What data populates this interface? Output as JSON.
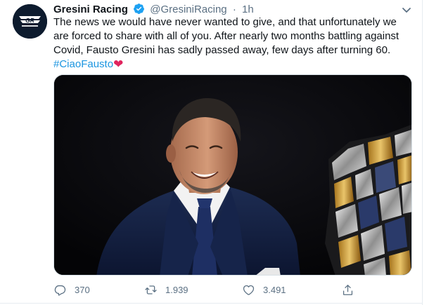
{
  "tweet": {
    "author": {
      "name": "Gresini Racing",
      "handle": "@GresiniRacing",
      "verified": true,
      "avatar_icon": "gresini-racing-logo",
      "avatar_logo_text": "GR"
    },
    "separator": "·",
    "time": "1h",
    "text_lines": [
      "The news we would have never wanted to give, and that unfortunately we",
      "are forced to share with all of you. After nearly two months battling against",
      "Covid, Fausto Gresini has sadly passed away, few days after turning 60."
    ],
    "hashtag": "#CiaoFausto",
    "emoji": "❤",
    "media": {
      "type": "photo",
      "subject": "man in suit smiling beside a trophy"
    },
    "actions": {
      "reply_count": "370",
      "retweet_count": "1.939",
      "like_count": "3.491"
    }
  },
  "colors": {
    "link": "#1b95e0",
    "verified_badge": "#1da1f2",
    "secondary_text": "#5b7083",
    "heart": "#e0245e"
  },
  "icons": [
    "verified-badge-icon",
    "more-caret-icon",
    "reply-icon",
    "retweet-icon",
    "like-icon",
    "share-icon"
  ]
}
